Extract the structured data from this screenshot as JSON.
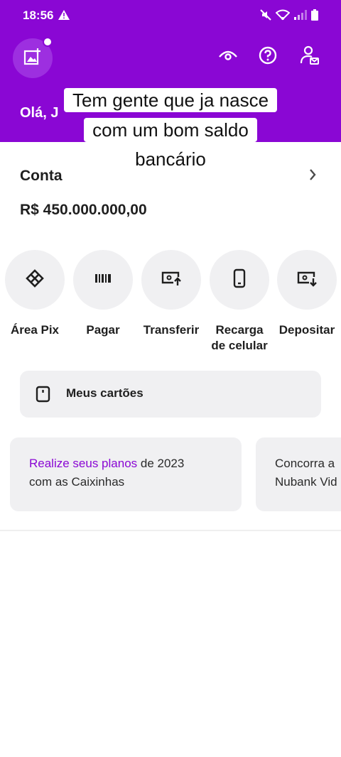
{
  "status_bar": {
    "time": "18:56"
  },
  "header": {
    "greeting": "Olá, J",
    "bg_color": "#8a07d4"
  },
  "caption": {
    "lines": [
      "Tem gente que ja nasce",
      "com um bom saldo",
      "bancário"
    ]
  },
  "account": {
    "title": "Conta",
    "balance": "R$ 450.000.000,00"
  },
  "actions": [
    {
      "label": "Área Pix",
      "icon": "pix-icon"
    },
    {
      "label": "Pagar",
      "icon": "barcode-icon"
    },
    {
      "label": "Transferir",
      "icon": "transfer-icon"
    },
    {
      "label": "Recarga\nde celular",
      "icon": "phone-icon"
    },
    {
      "label": "Depositar",
      "icon": "deposit-icon"
    }
  ],
  "cards_button": {
    "label": "Meus cartões",
    "icon": "card-icon"
  },
  "promos": [
    {
      "highlight": "Realize seus planos",
      "rest": " de 2023",
      "line2": "com as Caixinhas"
    },
    {
      "line1": "Concorra a",
      "line2": "Nubank Vid"
    }
  ]
}
